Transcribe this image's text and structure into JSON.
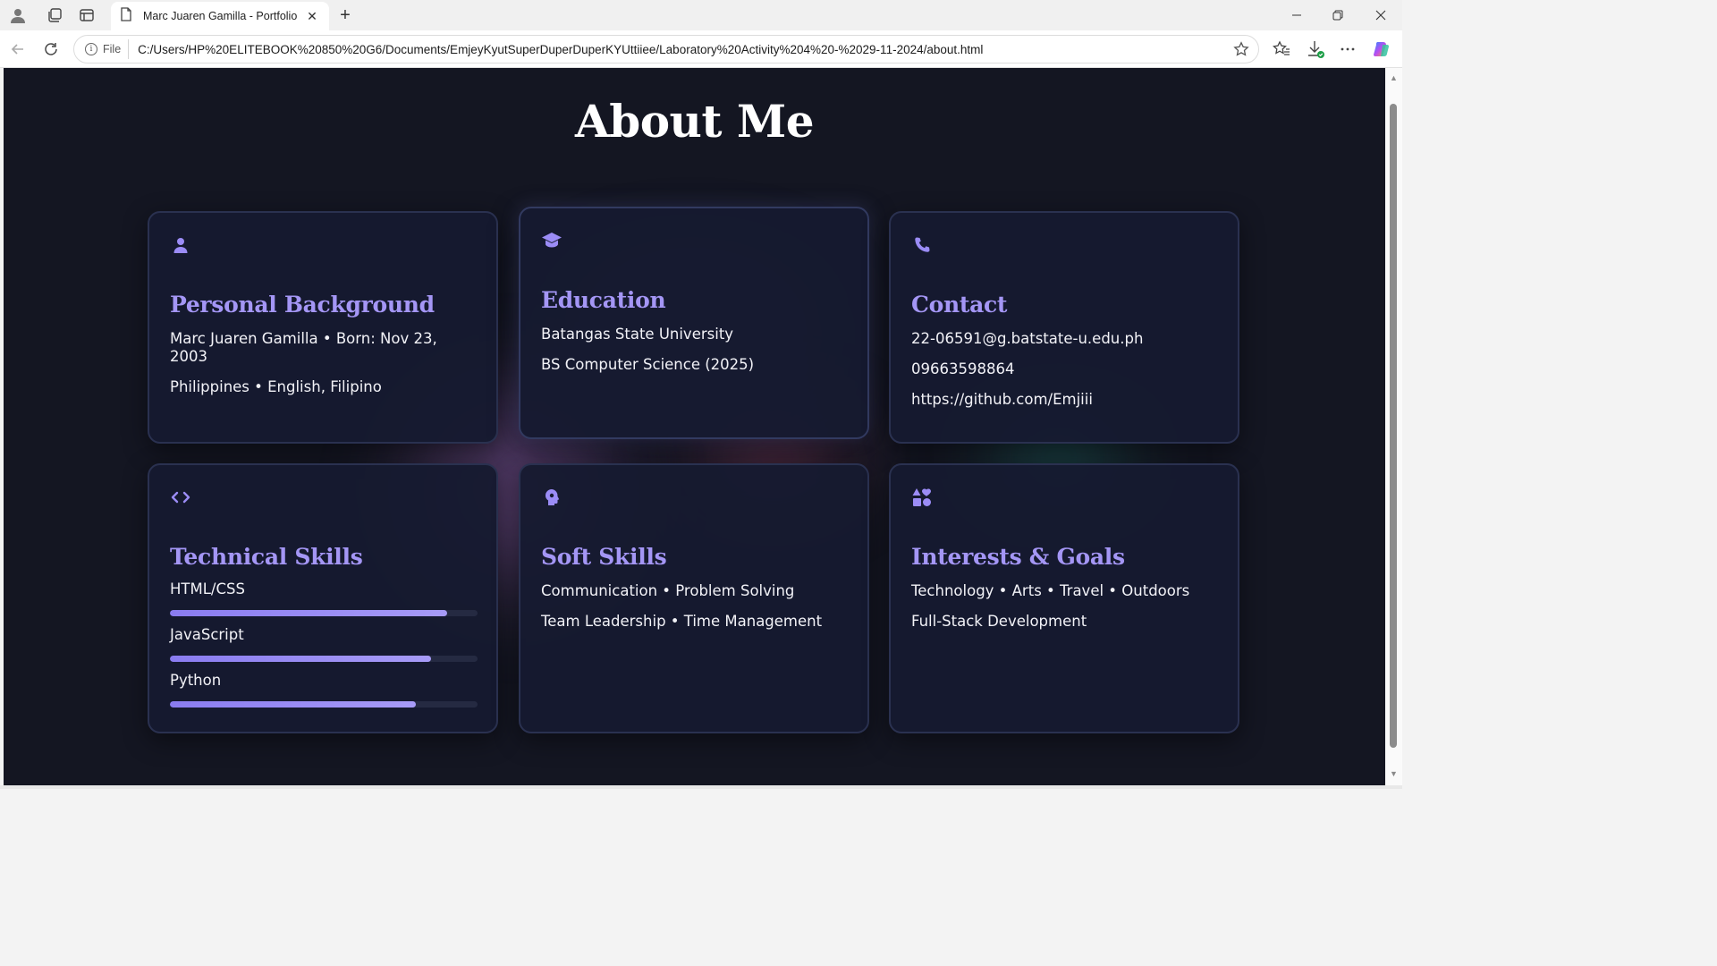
{
  "browser": {
    "tab_title": "Marc Juaren Gamilla - Portfolio",
    "file_label": "File",
    "url": "C:/Users/HP%20ELITEBOOK%20850%20G6/Documents/EmjeyKyutSuperDuperDuperKYUttiiee/Laboratory%20Activity%204%20-%2029-11-2024/about.html",
    "icons": [
      "profile-icon",
      "collections-icon",
      "tab-actions-icon",
      "page-icon",
      "close-icon",
      "plus-icon",
      "minimize-icon",
      "restore-icon",
      "window-close-icon",
      "back-icon",
      "reload-icon",
      "info-icon",
      "star-icon",
      "favorites-icon",
      "downloads-icon",
      "more-icon",
      "copilot-icon"
    ]
  },
  "page": {
    "title": "About Me",
    "accent_color": "#9b8cf6",
    "background_color": "#141622"
  },
  "cards": {
    "personal": {
      "icon": "user-icon",
      "title": "Personal Background",
      "lines": [
        "Marc Juaren Gamilla • Born: Nov 23, 2003",
        "Philippines • English, Filipino"
      ]
    },
    "education": {
      "icon": "graduation-cap-icon",
      "title": "Education",
      "lines": [
        "Batangas State University",
        "BS Computer Science (2025)"
      ]
    },
    "contact": {
      "icon": "phone-icon",
      "title": "Contact",
      "lines": [
        "22-06591@g.batstate-u.edu.ph",
        "09663598864",
        "https://github.com/Emjiii"
      ]
    },
    "technical": {
      "icon": "code-icon",
      "title": "Technical Skills",
      "skills": [
        {
          "label": "HTML/CSS",
          "level": 0.9
        },
        {
          "label": "JavaScript",
          "level": 0.85
        },
        {
          "label": "Python",
          "level": 0.8
        }
      ]
    },
    "soft": {
      "icon": "brain-icon",
      "title": "Soft Skills",
      "lines": [
        "Communication • Problem Solving",
        "Team Leadership • Time Management"
      ]
    },
    "interests": {
      "icon": "shapes-icon",
      "title": "Interests & Goals",
      "lines": [
        "Technology • Arts • Travel • Outdoors",
        "Full-Stack Development"
      ]
    }
  }
}
